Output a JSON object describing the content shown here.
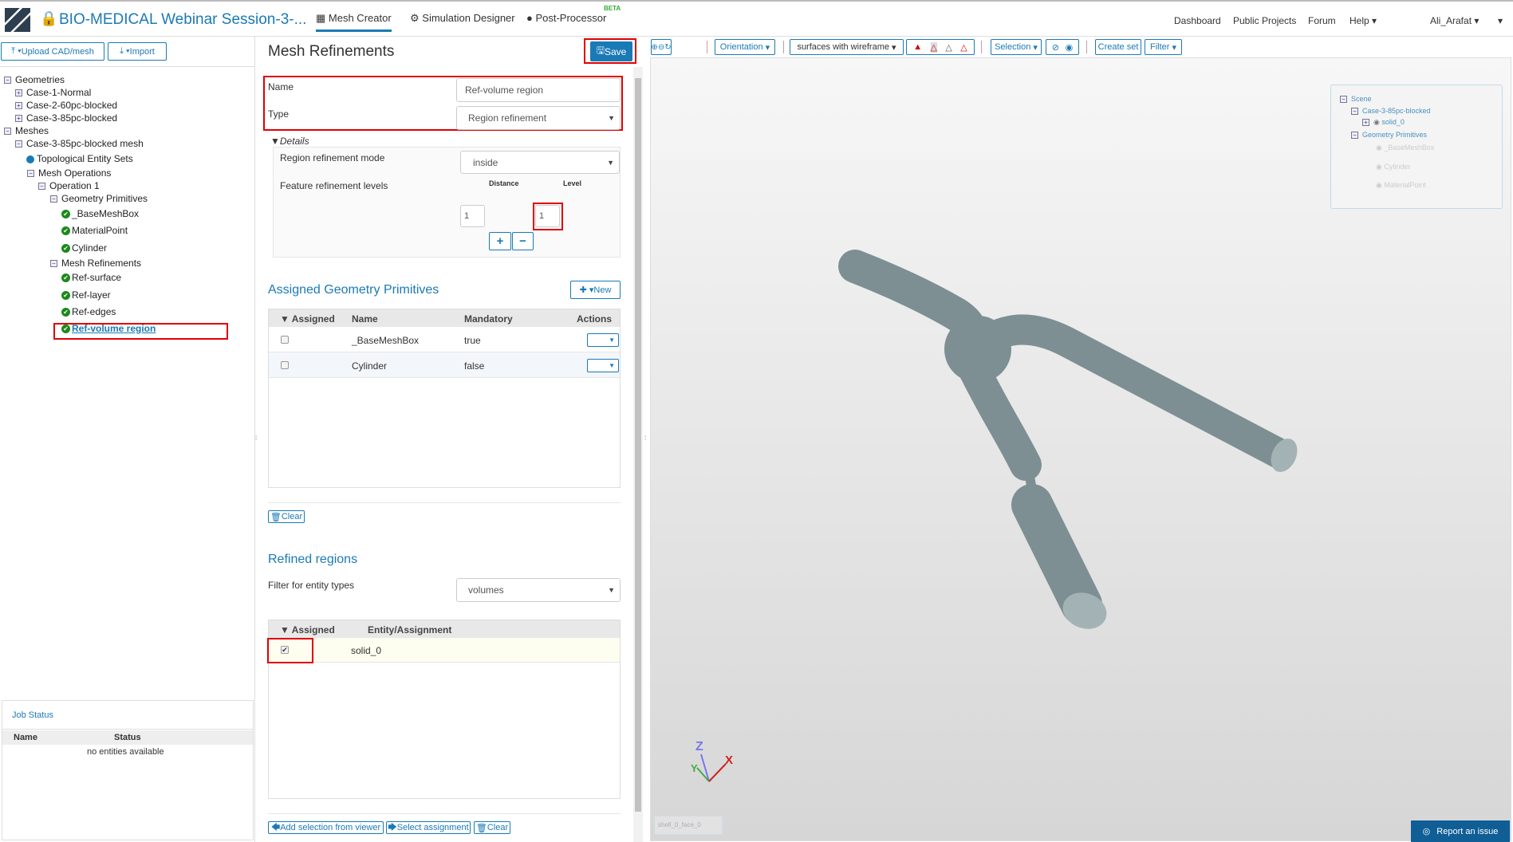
{
  "header": {
    "title": "BIO-MEDICAL Webinar Session-3-...",
    "tabs": [
      {
        "label": "Mesh Creator"
      },
      {
        "label": "Simulation Designer"
      },
      {
        "label": "Post-Processor",
        "badge": "BETA"
      }
    ],
    "nav": [
      "Dashboard",
      "Public Projects",
      "Forum",
      "Help"
    ],
    "user": "Ali_Arafat"
  },
  "left": {
    "upload": "Upload CAD/mesh",
    "import": "Import",
    "tree": [
      "Geometries",
      "Case-1-Normal",
      "Case-2-60pc-blocked",
      "Case-3-85pc-blocked",
      "Meshes",
      "Case-3-85pc-blocked mesh",
      "Topological Entity Sets",
      "Mesh Operations",
      "Operation 1",
      "Geometry Primitives",
      "_BaseMeshBox",
      "MaterialPoint",
      "Cylinder",
      "Mesh Refinements",
      "Ref-surface",
      "Ref-layer",
      "Ref-edges",
      "Ref-volume region"
    ],
    "job": {
      "title": "Job Status",
      "col_name": "Name",
      "col_status": "Status",
      "empty": "no entities available"
    }
  },
  "form": {
    "title": "Mesh Refinements",
    "save": "Save",
    "name_label": "Name",
    "name_value": "Ref-volume region",
    "type_label": "Type",
    "type_value": "Region refinement",
    "details": "Details",
    "mode_label": "Region refinement mode",
    "mode_value": "inside",
    "levels_label": "Feature refinement levels",
    "distance": "Distance",
    "level": "Level",
    "distance_value": "1",
    "level_value": "1",
    "agp": {
      "title": "Assigned Geometry Primitives",
      "new": "New",
      "cols": [
        "Assigned",
        "Name",
        "Mandatory",
        "Actions"
      ],
      "rows": [
        {
          "name": "_BaseMeshBox",
          "mandatory": "true"
        },
        {
          "name": "Cylinder",
          "mandatory": "false"
        }
      ],
      "clear": "Clear"
    },
    "regions": {
      "title": "Refined regions",
      "filter_label": "Filter for entity types",
      "filter_value": "volumes",
      "cols": [
        "Assigned",
        "Entity/Assignment"
      ],
      "rows": [
        {
          "entity": "solid_0",
          "checked": true
        }
      ],
      "add": "Add selection from viewer",
      "select": "Select assignment",
      "clear": "Clear"
    }
  },
  "viewer": {
    "orientation": "Orientation",
    "render_mode": "surfaces with wireframe",
    "selection": "Selection",
    "create_set": "Create set",
    "filter": "Filter",
    "scene": [
      "Scene",
      "Case-3-85pc-blocked",
      "solid_0",
      "Geometry Primitives",
      "_BaseMeshBox",
      "Cylinder",
      "MaterialPoint"
    ],
    "axes": {
      "x": "X",
      "y": "Y",
      "z": "Z"
    },
    "hover_field": "shell_0_face_0",
    "report": "Report an issue",
    "shape_color": "#7d8f92"
  }
}
